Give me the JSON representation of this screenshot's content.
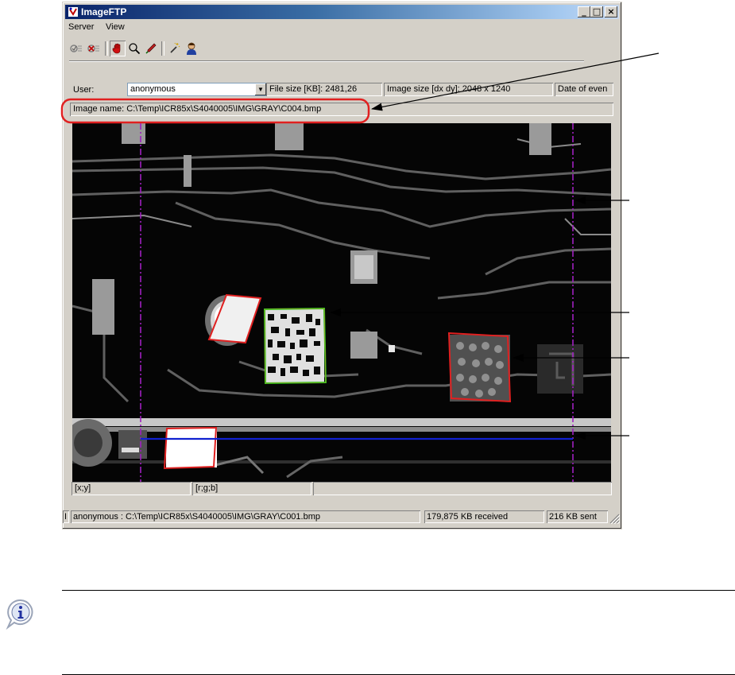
{
  "window": {
    "title": "ImageFTP",
    "minimize_label": "_",
    "maximize_label": "□",
    "close_label": "×"
  },
  "menu": {
    "items": [
      "Server",
      "View"
    ]
  },
  "toolbar": {
    "buttons": [
      "connect-icon",
      "disconnect-icon",
      "hand-icon",
      "zoom-icon",
      "pen-icon",
      "wand-icon",
      "user-icon"
    ]
  },
  "info": {
    "user_label": "User:",
    "user_value": "anonymous",
    "file_size": "File size [KB]: 2481,26",
    "image_size": "Image size [dx dy]: 2048 x 1240",
    "date": "Date of even",
    "image_name": "Image name: C:\\Temp\\ICR85x\\S4040005\\IMG\\GRAY\\C004.bmp"
  },
  "coords": {
    "xy": "[x;y]",
    "rgb": "[r;g;b]",
    "extra": ""
  },
  "status": {
    "indicator": "I",
    "path": "anonymous : C:\\Temp\\ICR85x\\S4040005\\IMG\\GRAY\\C001.bmp",
    "received": "179,875 KB received",
    "sent": "216 KB sent"
  },
  "colors": {
    "highlight_red": "#e02020",
    "guide_purple": "#a020c0",
    "scan_line_blue": "#1020d0",
    "code_green": "#20c020"
  }
}
